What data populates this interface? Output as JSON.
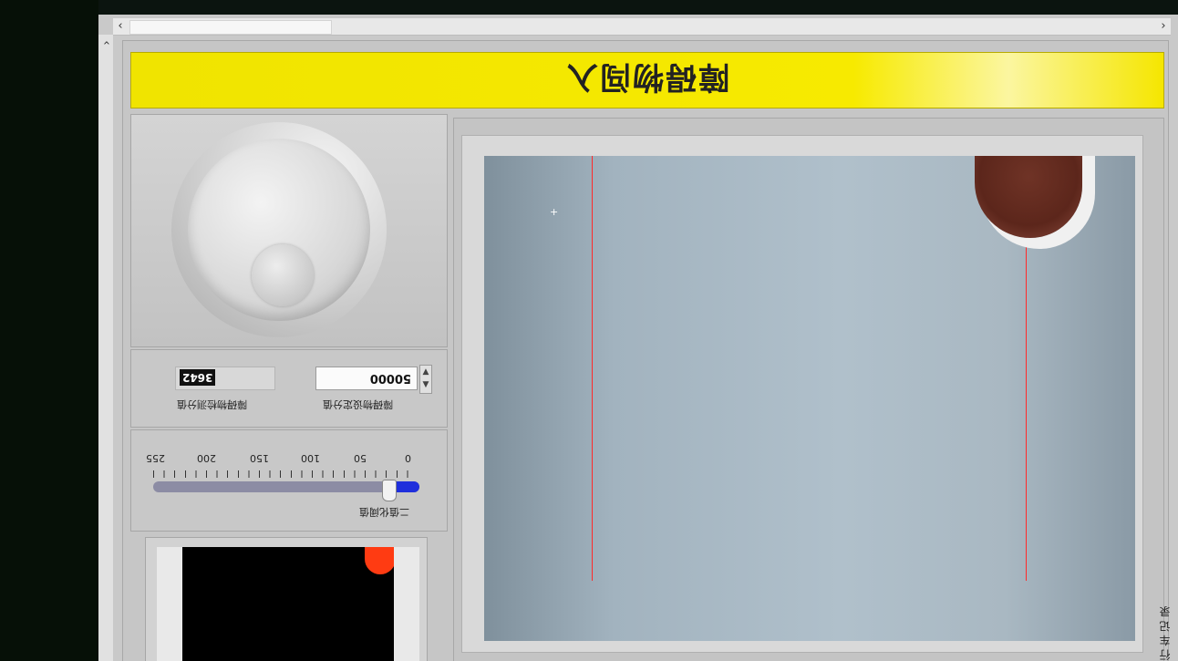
{
  "window": {
    "title": "障碍物闯入",
    "scroll_left": "‹",
    "scroll_right": "›",
    "scroll_up": "‹"
  },
  "knob": {
    "icon": "knob-dial-icon"
  },
  "values": {
    "setpoint_label": "障碍物设定分值",
    "setpoint_value": "50000",
    "measured_label": "障碍物检测分值",
    "measured_value": "3642",
    "stepper_up": "▲",
    "stepper_down": "▼"
  },
  "threshold": {
    "label": "二值化阈值",
    "min": 0,
    "max": 255,
    "value": 30,
    "ticks": [
      "0",
      "50",
      "100",
      "150",
      "200",
      "255"
    ]
  },
  "side_label": "行 车 记 录",
  "colors": {
    "title_bar": "#f4e600",
    "slider_fill": "#1f2fdc",
    "guide_line": "#ff2a2a",
    "thumb_blob": "#ff3b12"
  }
}
